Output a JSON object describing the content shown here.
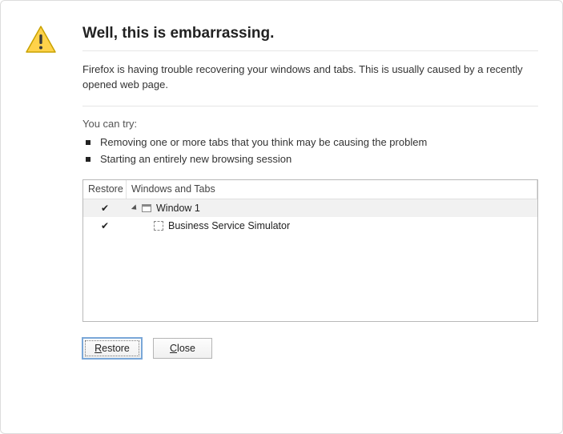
{
  "title": "Well, this is embarrassing.",
  "description": "Firefox is having trouble recovering your windows and tabs. This is usually caused by a recently opened web page.",
  "try_label": "You can try:",
  "try_items": [
    "Removing one or more tabs that you think may be causing the problem",
    "Starting an entirely new browsing session"
  ],
  "tree": {
    "col_restore": "Restore",
    "col_windows": "Windows and Tabs",
    "rows": [
      {
        "checked": true,
        "level": 1,
        "kind": "window",
        "label": "Window 1",
        "selected": true
      },
      {
        "checked": true,
        "level": 2,
        "kind": "tab",
        "label": "Business Service Simulator",
        "selected": false
      }
    ]
  },
  "buttons": {
    "restore": "Restore",
    "close": "Close"
  }
}
